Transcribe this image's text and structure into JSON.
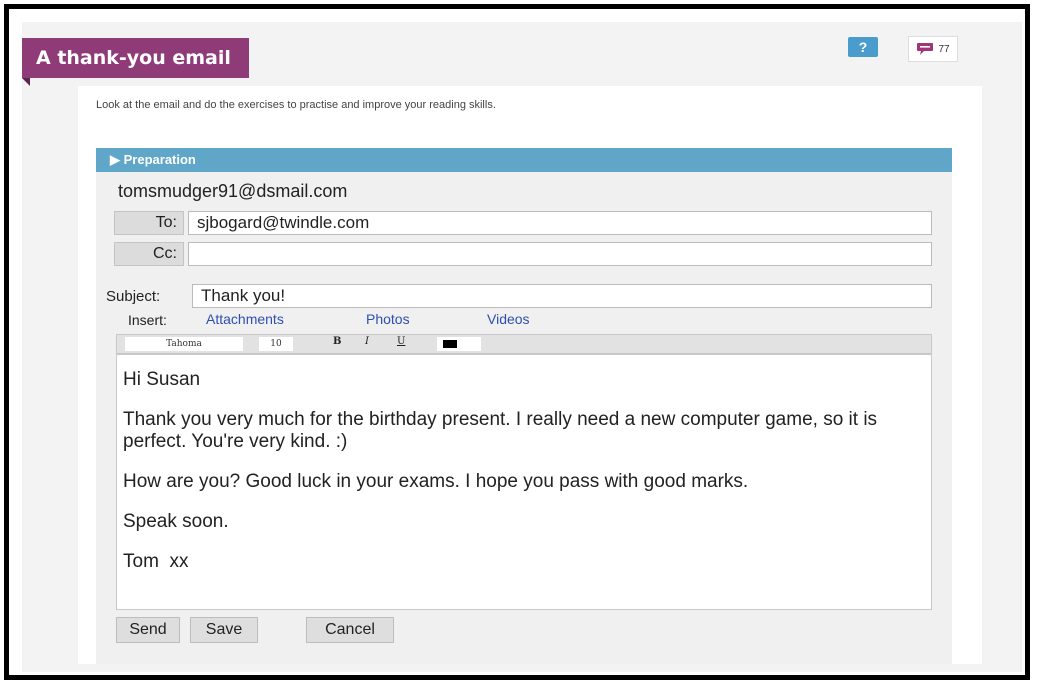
{
  "header": {
    "title": "A thank-you email",
    "help_label": "?",
    "comment_count": "77"
  },
  "intro_text": "Look at the email and do the exercises to practise and improve your reading skills.",
  "preparation_label": "Preparation",
  "email": {
    "from": "tomsmudger91@dsmail.com",
    "to_label": "To:",
    "to_value": "sjbogard@twindle.com",
    "cc_label": "Cc:",
    "cc_value": "",
    "subject_label": "Subject:",
    "subject_value": "Thank you!",
    "insert_label": "Insert:",
    "insert_links": [
      "Attachments",
      "Photos",
      "Videos"
    ],
    "toolbar": {
      "font": "Tahoma",
      "size": "10",
      "bold": "B",
      "italic": "I",
      "underline": "U",
      "text_color": "#000000"
    },
    "body_paragraphs": [
      "Hi Susan",
      "Thank you very much for the birthday present. I really need a new computer game, so it is perfect. You're very kind. :)",
      "How are you? Good luck in your exams. I hope you pass with good marks.",
      "Speak soon.",
      "Tom  xx"
    ],
    "buttons": {
      "send": "Send",
      "save": "Save",
      "cancel": "Cancel"
    }
  },
  "colors": {
    "title_tab": "#8e3b78",
    "preparation_bar": "#5fa6c9",
    "help_button": "#4a9ccc",
    "comment_icon": "#a0367a",
    "link": "#2e4fb0"
  }
}
